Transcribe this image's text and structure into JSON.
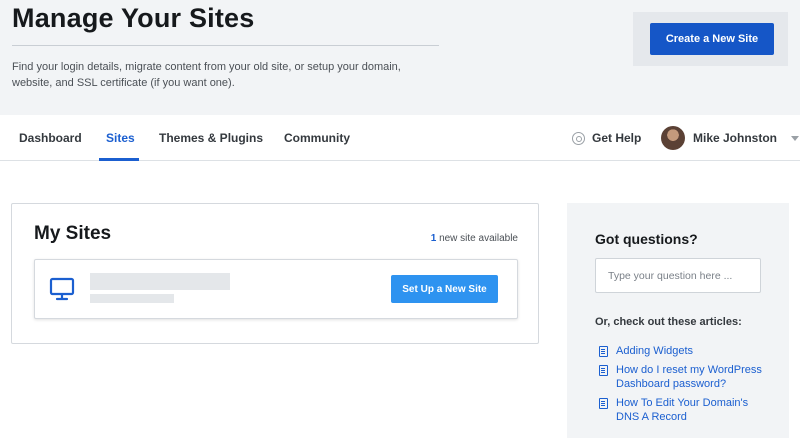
{
  "header": {
    "title": "Manage Your Sites",
    "subtitle": "Find your login details, migrate content from your old site, or setup your domain, website, and SSL certificate (if you want one).",
    "create_button": "Create a New Site"
  },
  "nav": {
    "tabs": [
      {
        "label": "Dashboard",
        "active": false
      },
      {
        "label": "Sites",
        "active": true
      },
      {
        "label": "Themes & Plugins",
        "active": false
      },
      {
        "label": "Community",
        "active": false
      }
    ],
    "help_label": "Get Help",
    "user_name": "Mike Johnston"
  },
  "my_sites": {
    "title": "My Sites",
    "available_count": "1",
    "available_text": "new site available",
    "setup_button": "Set Up a New Site"
  },
  "questions": {
    "title": "Got questions?",
    "placeholder": "Type your question here ...",
    "articles_heading": "Or, check out these articles:",
    "articles": [
      "Adding Widgets",
      "How do I reset my WordPress Dashboard password?",
      "How To Edit Your Domain's DNS A Record"
    ]
  },
  "colors": {
    "primary": "#1556c7",
    "accent": "#2e93f0",
    "link": "#1b5fd0"
  }
}
